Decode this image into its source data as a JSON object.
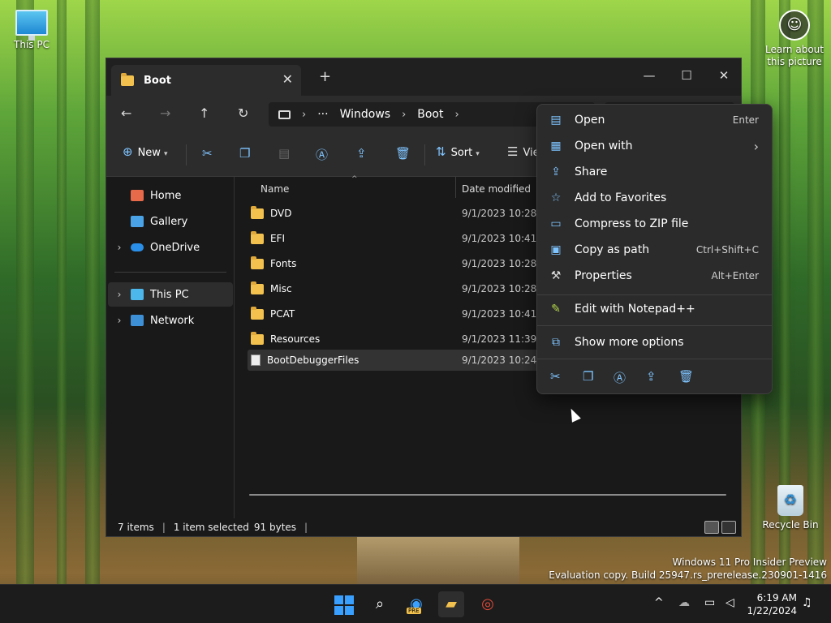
{
  "desktop": {
    "icons": [
      {
        "label": "This PC"
      },
      {
        "label": "Learn about this picture"
      },
      {
        "label": "Recycle Bin"
      }
    ],
    "watermark": {
      "line1": "Windows 11 Pro Insider Preview",
      "line2": "Evaluation copy. Build 25947.rs_prerelease.230901-1416"
    }
  },
  "explorer": {
    "tab_title": "Boot",
    "address": {
      "ellipsis": "···",
      "crumbs": [
        "Windows",
        "Boot"
      ]
    },
    "commands": {
      "new_label": "New",
      "sort_label": "Sort",
      "view_label": "View"
    },
    "nav": {
      "items": [
        "Home",
        "Gallery",
        "OneDrive",
        "This PC",
        "Network"
      ]
    },
    "columns": {
      "name": "Name",
      "date": "Date modified"
    },
    "rows": [
      {
        "name": "DVD",
        "date": "9/1/2023 10:28 PM"
      },
      {
        "name": "EFI",
        "date": "9/1/2023 10:41 PM"
      },
      {
        "name": "Fonts",
        "date": "9/1/2023 10:28 PM"
      },
      {
        "name": "Misc",
        "date": "9/1/2023 10:28 PM"
      },
      {
        "name": "PCAT",
        "date": "9/1/2023 10:41 PM"
      },
      {
        "name": "Resources",
        "date": "9/1/2023 11:39 PM"
      },
      {
        "name": "BootDebuggerFiles",
        "date": "9/1/2023 10:24 PM"
      }
    ],
    "status": {
      "count": "7 items",
      "selected": "1 item selected",
      "size": "91 bytes"
    }
  },
  "context_menu": {
    "items": [
      {
        "label": "Open",
        "shortcut": "Enter"
      },
      {
        "label": "Open with",
        "shortcut": ""
      },
      {
        "label": "Share",
        "shortcut": ""
      },
      {
        "label": "Add to Favorites",
        "shortcut": ""
      },
      {
        "label": "Compress to ZIP file",
        "shortcut": ""
      },
      {
        "label": "Copy as path",
        "shortcut": "Ctrl+Shift+C"
      },
      {
        "label": "Properties",
        "shortcut": "Alt+Enter"
      },
      {
        "label": "Edit with Notepad++",
        "shortcut": ""
      },
      {
        "label": "Show more options",
        "shortcut": ""
      }
    ],
    "submenu_arrow": "›"
  },
  "taskbar": {
    "time": "6:19 AM",
    "date": "1/22/2024",
    "edge_badge": "PRE"
  },
  "colors": {
    "accent": "#7fc4ff",
    "folder": "#f2c14e",
    "window_bg": "#191919",
    "menu_bg": "#2b2b2b"
  }
}
